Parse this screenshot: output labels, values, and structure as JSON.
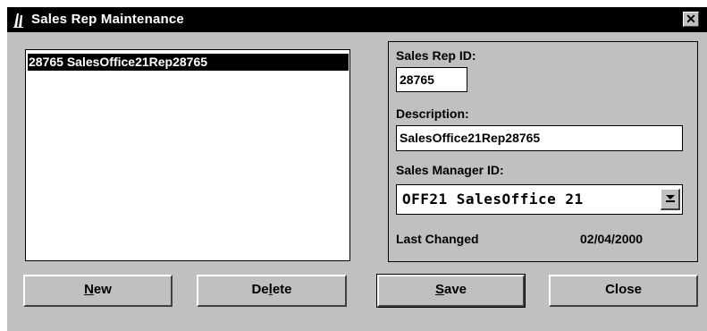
{
  "window": {
    "title": "Sales Rep Maintenance",
    "close_glyph": "✕"
  },
  "list": {
    "items": [
      {
        "label": "28765 SalesOffice21Rep28765",
        "selected": true
      }
    ]
  },
  "form": {
    "sales_rep_id_label": "Sales Rep ID:",
    "sales_rep_id_value": "28765",
    "description_label": "Description:",
    "description_value": "SalesOffice21Rep28765",
    "sales_manager_id_label": "Sales Manager ID:",
    "sales_manager_id_value": "OFF21 SalesOffice 21",
    "last_changed_label": "Last Changed",
    "last_changed_value": "02/04/2000"
  },
  "buttons": {
    "new": {
      "before": "",
      "mnemonic": "N",
      "after": "ew"
    },
    "delete": {
      "before": "De",
      "mnemonic": "l",
      "after": "ete"
    },
    "save": {
      "before": "",
      "mnemonic": "S",
      "after": "ave"
    },
    "close": {
      "label": "Close"
    }
  },
  "icons": {
    "app": "app-icon",
    "close": "close-icon",
    "dropdown": "chevron-down-icon"
  }
}
